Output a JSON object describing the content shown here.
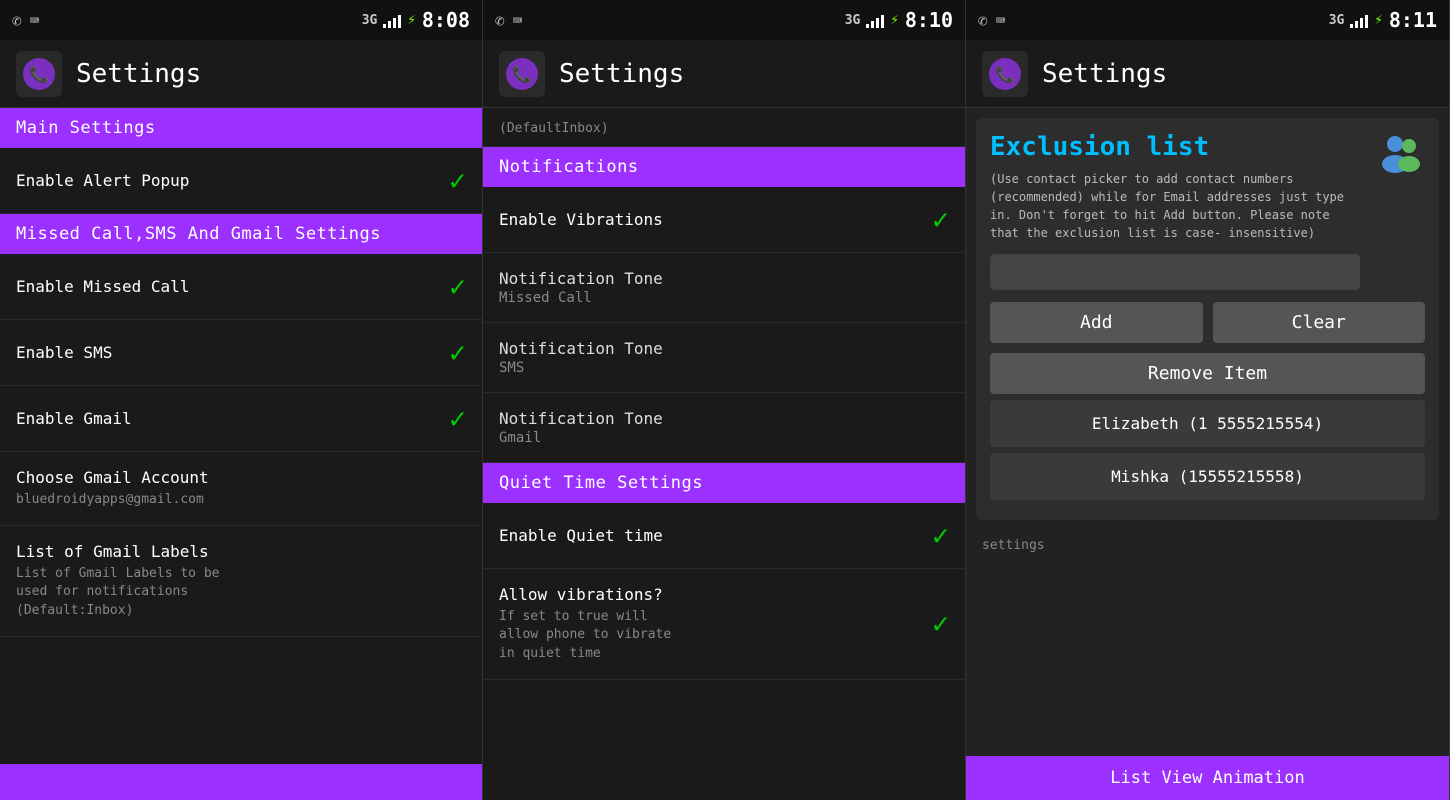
{
  "panels": [
    {
      "id": "panel1",
      "statusBar": {
        "time": "8:08",
        "network": "3G"
      },
      "header": {
        "title": "Settings"
      },
      "sections": [
        {
          "type": "header",
          "label": "Main Settings"
        },
        {
          "type": "row",
          "title": "Enable Alert Popup",
          "checked": true
        },
        {
          "type": "header",
          "label": "Missed Call,SMS And Gmail Settings"
        },
        {
          "type": "row",
          "title": "Enable Missed Call",
          "checked": true
        },
        {
          "type": "row",
          "title": "Enable SMS",
          "checked": true
        },
        {
          "type": "row",
          "title": "Enable Gmail",
          "checked": true
        },
        {
          "type": "row",
          "title": "Choose Gmail Account",
          "subtitle": "bluedroidyapps@gmail.com",
          "checked": false
        },
        {
          "type": "row",
          "title": "List of Gmail Labels",
          "subtitle": "List of Gmail Labels to be\nused for notifications\n(Default:Inbox)",
          "checked": false
        }
      ],
      "bottomBar": {
        "label": ""
      }
    },
    {
      "id": "panel2",
      "statusBar": {
        "time": "8:10",
        "network": "3G"
      },
      "header": {
        "title": "Settings"
      },
      "topNote": "(DefaultInbox)",
      "sections": [
        {
          "type": "header",
          "label": "Notifications"
        },
        {
          "type": "row",
          "title": "Enable Vibrations",
          "checked": true
        },
        {
          "type": "tone",
          "title": "Notification Tone",
          "value": "Missed Call"
        },
        {
          "type": "tone",
          "title": "Notification Tone",
          "value": "SMS"
        },
        {
          "type": "tone",
          "title": "Notification Tone",
          "value": "Gmail"
        },
        {
          "type": "header",
          "label": "Quiet Time Settings"
        },
        {
          "type": "row",
          "title": "Enable Quiet time",
          "checked": true
        },
        {
          "type": "row",
          "title": "Allow vibrations?",
          "subtitle": "If set to true will\nallow phone to vibrate\nin quiet time",
          "checked": true
        }
      ]
    },
    {
      "id": "panel3",
      "statusBar": {
        "time": "8:11",
        "network": "3G"
      },
      "header": {
        "title": "Settings"
      },
      "exclusionList": {
        "title": "Exclusion list",
        "description": "(Use contact picker to add contact numbers (recommended) while for Email addresses just type in. Don't forget to hit Add button. Please note that the exclusion list is case- insensitive)",
        "addLabel": "Add",
        "clearLabel": "Clear",
        "removeLabel": "Remove Item",
        "contacts": [
          "Elizabeth (1 5555215554)",
          "Mishka (15555215558)"
        ]
      },
      "settingsLabel": "settings",
      "bottomBarLabel": "List View Animation"
    }
  ]
}
